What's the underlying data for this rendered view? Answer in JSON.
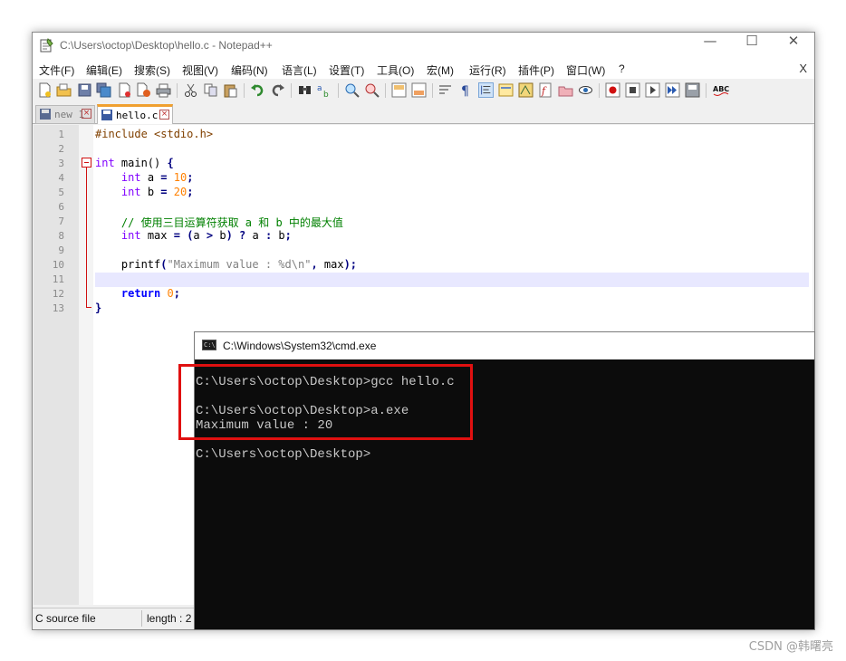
{
  "notepad": {
    "title": "C:\\Users\\octop\\Desktop\\hello.c - Notepad++",
    "window_controls": {
      "minimize": "—",
      "maximize": "☐",
      "close": "✕"
    },
    "menu": [
      "文件(F)",
      "编辑(E)",
      "搜索(S)",
      "视图(V)",
      "编码(N)",
      "语言(L)",
      "设置(T)",
      "工具(O)",
      "宏(M)",
      "运行(R)",
      "插件(P)",
      "窗口(W)",
      "?"
    ],
    "menu_close": "X",
    "toolbar_icons": [
      "new-file-icon",
      "open-file-icon",
      "save-icon",
      "save-all-icon",
      "close-icon",
      "close-all-icon",
      "print-icon",
      "cut-icon",
      "copy-icon",
      "paste-icon",
      "undo-icon",
      "redo-icon",
      "find-icon",
      "replace-icon",
      "zoom-in-icon",
      "zoom-out-icon",
      "sync-v-icon",
      "sync-h-icon",
      "word-wrap-icon",
      "show-all-chars-icon",
      "indent-guide-icon",
      "udl-icon",
      "doc-map-icon",
      "function-list-icon",
      "folder-workspace-icon",
      "monitoring-icon",
      "record-macro-icon",
      "stop-macro-icon",
      "play-macro-icon",
      "run-macro-multiple-icon",
      "save-macro-icon",
      "spell-check-icon"
    ],
    "tabs": [
      {
        "label": "new 1",
        "active": false
      },
      {
        "label": "hello.c",
        "active": true
      }
    ],
    "code_lines": [
      {
        "num": "1",
        "text": "#include <stdio.h>"
      },
      {
        "num": "2",
        "text": ""
      },
      {
        "num": "3",
        "text": "int main() {"
      },
      {
        "num": "4",
        "text": "    int a = 10;"
      },
      {
        "num": "5",
        "text": "    int b = 20;"
      },
      {
        "num": "6",
        "text": ""
      },
      {
        "num": "7",
        "text": "    // 使用三目运算符获取 a 和 b 中的最大值"
      },
      {
        "num": "8",
        "text": "    int max = (a > b) ? a : b;"
      },
      {
        "num": "9",
        "text": ""
      },
      {
        "num": "10",
        "text": "    printf(\"Maximum value : %d\\n\", max);"
      },
      {
        "num": "11",
        "text": ""
      },
      {
        "num": "12",
        "text": "    return 0;"
      },
      {
        "num": "13",
        "text": "}"
      }
    ],
    "status": {
      "language": "C source file",
      "length": "length : 2"
    }
  },
  "cmd": {
    "title": "C:\\Windows\\System32\\cmd.exe",
    "icon_text": "C:\\",
    "lines": [
      "C:\\Users\\octop\\Desktop>gcc hello.c",
      "",
      "C:\\Users\\octop\\Desktop>a.exe",
      "Maximum value : 20",
      "",
      "C:\\Users\\octop\\Desktop>"
    ]
  },
  "watermark": "CSDN @韩曙亮",
  "colors": {
    "highlight_box": "#e01010",
    "cmd_background": "#0c0c0c",
    "keyword": "#0000ff",
    "type": "#8000ff",
    "number": "#ff8000",
    "comment": "#008000"
  }
}
